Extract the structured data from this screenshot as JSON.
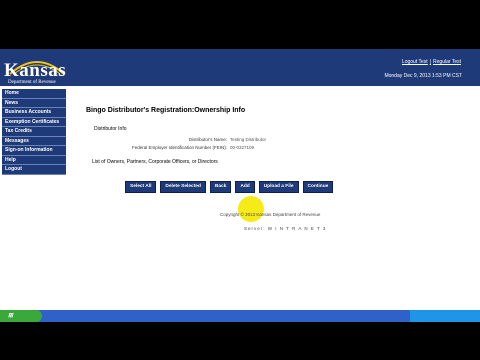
{
  "header": {
    "logo_text": "Kansas",
    "logo_subtext": "Department of Revenue",
    "links": [
      "Logout Test",
      "Regular Test"
    ],
    "link_separator": "|",
    "datetime": "Monday Dec 9, 2013 1:53 PM CST"
  },
  "sidebar": {
    "items": [
      {
        "label": "Home"
      },
      {
        "label": "News"
      },
      {
        "label": "Business Accounts"
      },
      {
        "label": "Exemption Certificates"
      },
      {
        "label": "Tax Credits"
      },
      {
        "label": "Messages"
      },
      {
        "label": "Sign-on Information"
      },
      {
        "label": "Help"
      },
      {
        "label": "Logout"
      }
    ]
  },
  "main": {
    "title": "Bingo Distributor's Registration:Ownership Info",
    "section_label": "Distributor Info",
    "fields": [
      {
        "label": "Distributor's Name:",
        "value": "Testing Distributor"
      },
      {
        "label": "Federal Employer Identification Number (FEIN):",
        "value": "00-0327109"
      }
    ],
    "list_label": "List of Owners, Partners, Corporate Officers, or Directors"
  },
  "buttons": {
    "select_all": "Select All",
    "delete_selected": "Delete Selected",
    "back": "Back",
    "add": "Add",
    "upload": "Upload a File",
    "continue": "Continue"
  },
  "footer": {
    "copyright": "Copyright © 2013 Kansas Department of Revenue",
    "server": "Server: W I N T R A N E T 3"
  },
  "colors": {
    "brand_blue": "#1f3a78",
    "taskbar_blue": "#2f61c8",
    "start_green": "#3aa83a"
  }
}
